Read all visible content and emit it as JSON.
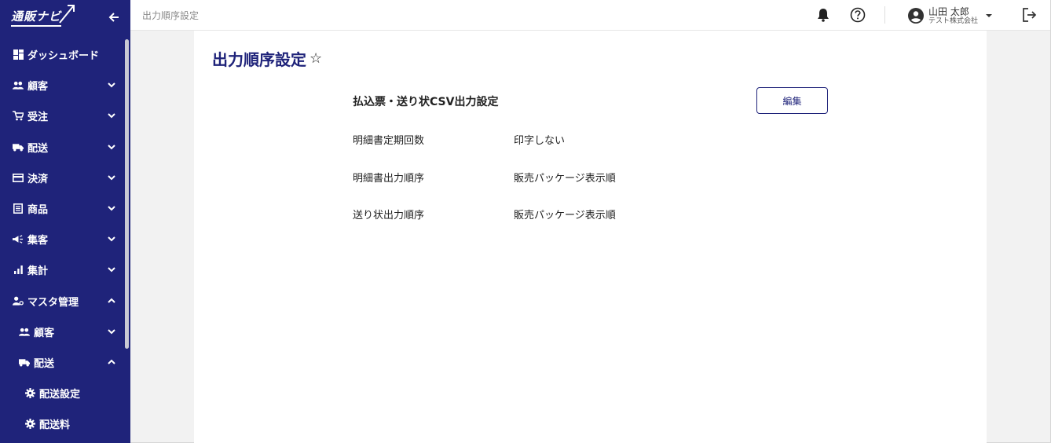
{
  "sidebar": {
    "logo_text": "通販ナビ",
    "items": [
      {
        "label": "ダッシュボード",
        "icon": "dashboard-icon",
        "chevron": ""
      },
      {
        "label": "顧客",
        "icon": "people-icon",
        "chevron": "down"
      },
      {
        "label": "受注",
        "icon": "cart-icon",
        "chevron": "down"
      },
      {
        "label": "配送",
        "icon": "truck-icon",
        "chevron": "down"
      },
      {
        "label": "決済",
        "icon": "card-icon",
        "chevron": "down"
      },
      {
        "label": "商品",
        "icon": "list-icon",
        "chevron": "down"
      },
      {
        "label": "集客",
        "icon": "megaphone-icon",
        "chevron": "down"
      },
      {
        "label": "集計",
        "icon": "bar-chart-icon",
        "chevron": "down"
      },
      {
        "label": "マスタ管理",
        "icon": "person-gear-icon",
        "chevron": "up"
      },
      {
        "label": "顧客",
        "icon": "people-icon",
        "chevron": "down"
      },
      {
        "label": "配送",
        "icon": "truck-icon",
        "chevron": "up"
      },
      {
        "label": "配送設定",
        "icon": "gear-icon",
        "chevron": ""
      },
      {
        "label": "配送料",
        "icon": "gear-icon",
        "chevron": ""
      }
    ]
  },
  "topbar": {
    "breadcrumb": "出力順序設定",
    "user_name": "山田 太郎",
    "user_company": "テスト株式会社"
  },
  "main": {
    "page_title": "出力順序設定",
    "star": "☆",
    "section_title": "払込票・送り状CSV出力設定",
    "edit_label": "編集",
    "rows": [
      {
        "label": "明細書定期回数",
        "value": "印字しない"
      },
      {
        "label": "明細書出力順序",
        "value": "販売パッケージ表示順"
      },
      {
        "label": "送り状出力順序",
        "value": "販売パッケージ表示順"
      }
    ]
  },
  "colors": {
    "sidebar_bg": "#1f237a",
    "accent": "#1f237a",
    "page_bg": "#f2f2f2"
  }
}
